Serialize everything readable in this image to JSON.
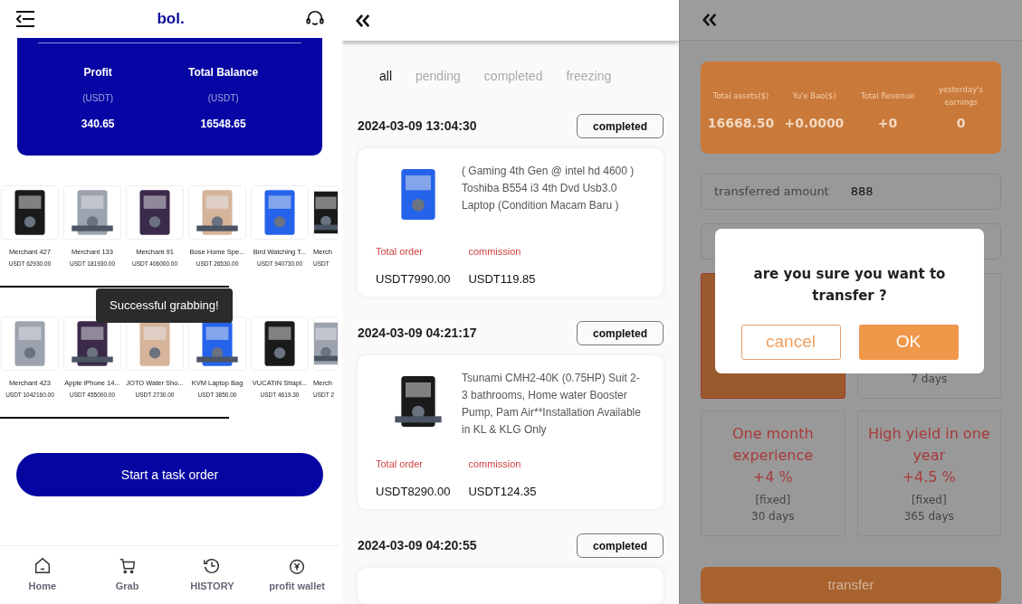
{
  "home": {
    "logo": "bol.",
    "summary": [
      {
        "label": "Profit",
        "unit": "(USDT)",
        "value": "340.65"
      },
      {
        "label": "Total Balance",
        "unit": "(USDT)",
        "value": "16548.65"
      }
    ],
    "product_rows": [
      [
        {
          "name": "Merchant 427",
          "price": "USDT 62930.00"
        },
        {
          "name": "Merchant 133",
          "price": "USDT 181930.00"
        },
        {
          "name": "Merchant 91",
          "price": "USDT 406000.00"
        },
        {
          "name": "Bose Home Spe...",
          "price": "USDT 26530.00"
        },
        {
          "name": "Bird Watching T...",
          "price": "USDT 940730.00"
        },
        {
          "name": "Merch",
          "price": "USDT"
        }
      ],
      [
        {
          "name": "Merchant 423",
          "price": "USDT 1042160.00"
        },
        {
          "name": "Apple iPhone 14...",
          "price": "USDT 455000.00"
        },
        {
          "name": "JOTO Water Sho...",
          "price": "USDT 2730.00"
        },
        {
          "name": "KVM Laptop Bag",
          "price": "USDT 3850.00"
        },
        {
          "name": "VUCATIN Strapl...",
          "price": "USDT 4619.30"
        },
        {
          "name": "Merch",
          "price": "USDT 2"
        }
      ]
    ],
    "toast": "Successful grabbing!",
    "start_button": "Start a task order",
    "nav": [
      {
        "label": "Home",
        "kind": "home"
      },
      {
        "label": "Grab",
        "kind": "cart"
      },
      {
        "label": "HISTORY",
        "kind": "history"
      },
      {
        "label": "profit wallet",
        "kind": "wallet"
      }
    ]
  },
  "orders": {
    "tabs": [
      {
        "label": "all",
        "selected": true
      },
      {
        "label": "pending",
        "selected": false
      },
      {
        "label": "completed",
        "selected": false
      },
      {
        "label": "freezing",
        "selected": false
      }
    ],
    "items": [
      {
        "time": "2024-03-09 13:04:30",
        "status": "completed",
        "title": "( Gaming 4th Gen @ intel hd 4600 ) Toshiba B554 i3 4th Dvd Usb3.0 Laptop (Condition Macam Baru )",
        "total_label": "Total order",
        "total": "USDT7990.00",
        "commission_label": "commission",
        "commission": "USDT119.85"
      },
      {
        "time": "2024-03-09 04:21:17",
        "status": "completed",
        "title": "Tsunami CMH2-40K (0.75HP) Suit 2-3 bathrooms, Home water Booster Pump, Pam Air**Installation Available in KL & KLG Only",
        "total_label": "Total order",
        "total": "USDT8290.00",
        "commission_label": "commission",
        "commission": "USDT124.35"
      },
      {
        "time": "2024-03-09 04:20:55",
        "status": "completed"
      }
    ]
  },
  "wallet": {
    "stats": [
      {
        "label": "Total assets($)",
        "value": "16668.50"
      },
      {
        "label": "Yu'e Bao($)",
        "value": "+0.0000"
      },
      {
        "label": "Total Revenue",
        "value": "+0"
      },
      {
        "label": "yesterday's earnings",
        "value": "0"
      }
    ],
    "amount_field": {
      "label": "transferred amount",
      "value": "888"
    },
    "plans": [
      {
        "selected": true
      },
      {
        "selected": false,
        "duration": "7 days"
      },
      {
        "selected": false,
        "title": "One month experience",
        "rate": "+4 %",
        "note": "[fixed]",
        "duration": "30 days"
      },
      {
        "selected": false,
        "title": "High yield in one year",
        "rate": "+4.5 %",
        "note": "[fixed]",
        "duration": "365 days"
      }
    ],
    "transfer_button": "transfer",
    "dialog": {
      "message": "are you sure you want to transfer ?",
      "cancel": "cancel",
      "ok": "OK"
    }
  }
}
